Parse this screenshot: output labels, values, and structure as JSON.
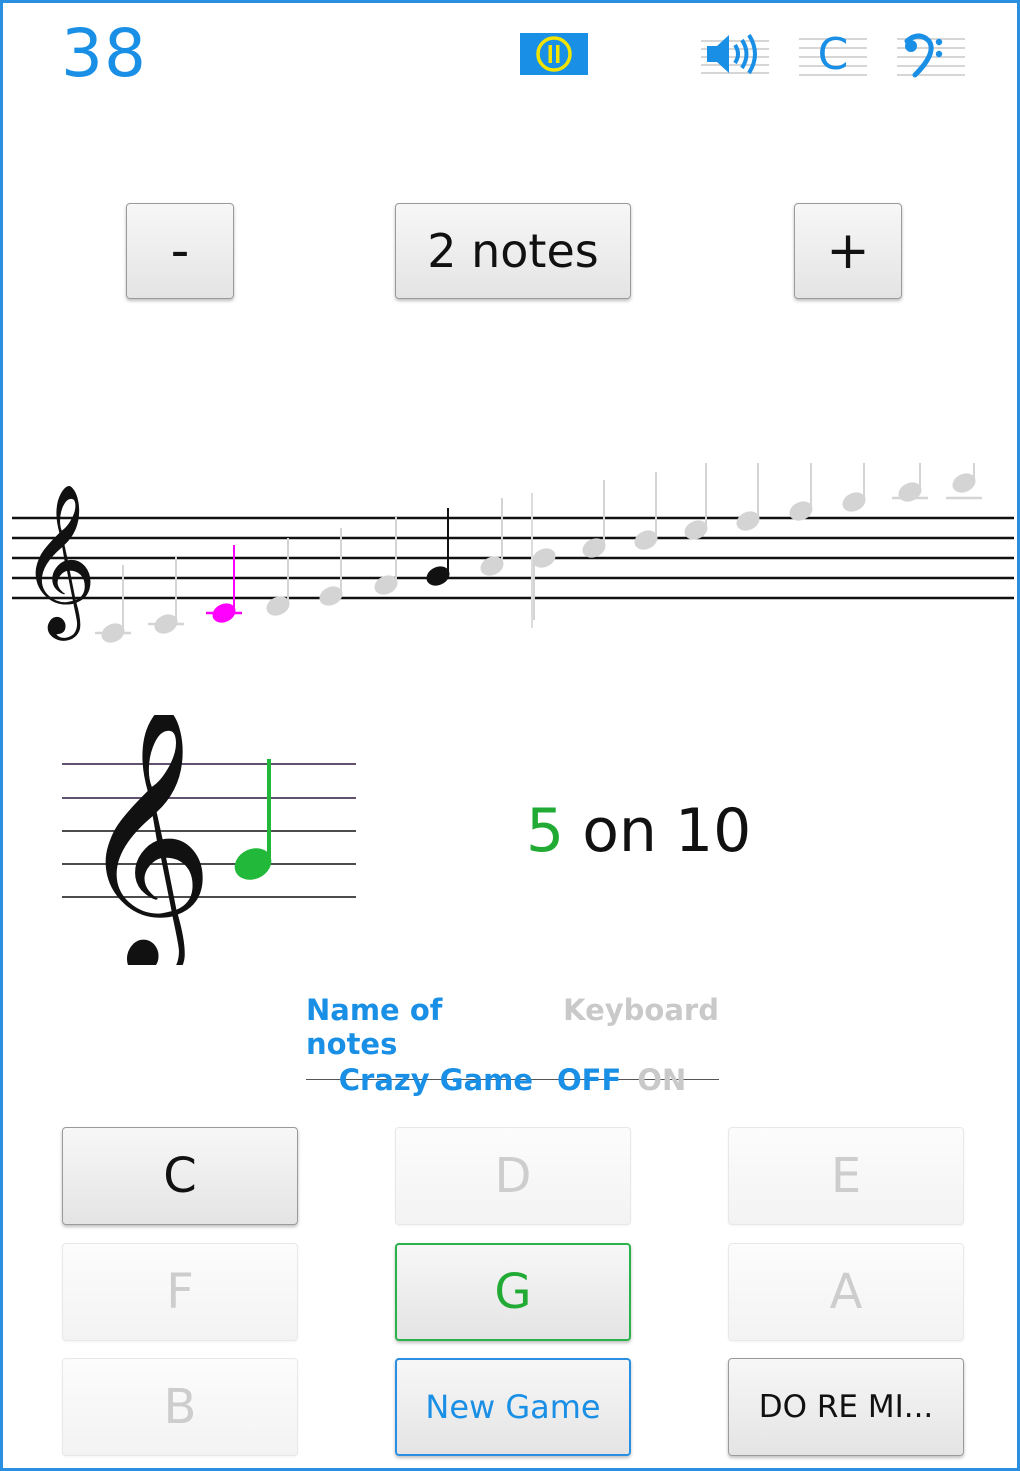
{
  "header": {
    "score": "38",
    "pause_icon": "pause-circle-icon",
    "sound_icon": "speaker-icon",
    "clef_c_label": "C",
    "bass_clef_icon": "bass-clef-icon"
  },
  "stepper": {
    "minus_label": "-",
    "count_label": "2 notes",
    "plus_label": "+"
  },
  "staff": {
    "clef": "treble-clef",
    "selected_color": "#ff00ff"
  },
  "result": {
    "current": "5",
    "separator": "on",
    "total": "10"
  },
  "modes": {
    "names_label": "Name of notes",
    "keyboard_label": "Keyboard"
  },
  "crazy_game": {
    "label": "Crazy Game",
    "off_label": "OFF",
    "on_label": "ON"
  },
  "buttons": {
    "c": "C",
    "d": "D",
    "e": "E",
    "f": "F",
    "g": "G",
    "a": "A",
    "b": "B",
    "new_game": "New Game",
    "solfege": "DO RE MI..."
  },
  "colors": {
    "accent": "#1a8fe6",
    "correct": "#22ab34",
    "highlight": "#ff00ff"
  }
}
